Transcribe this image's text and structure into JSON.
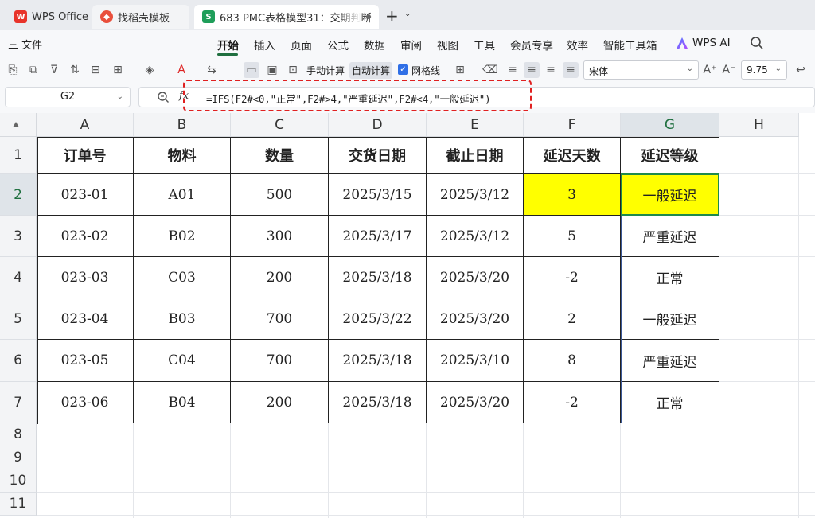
{
  "tabs": [
    {
      "label": "WPS Office",
      "icon": "wps-logo-icon"
    },
    {
      "label": "找稻壳模板",
      "icon": "docer-icon"
    },
    {
      "label": "683 PMC表格模型31：交期判断",
      "icon": "sheet-icon",
      "icon_text": "S"
    }
  ],
  "menu": {
    "file": "三 文件",
    "items": [
      "开始",
      "插入",
      "页面",
      "公式",
      "数据",
      "审阅",
      "视图",
      "工具",
      "会员专享",
      "效率",
      "智能工具箱"
    ],
    "active": "开始",
    "ai": "WPS AI"
  },
  "toolbar": {
    "manual_calc": "手动计算",
    "auto_calc": "自动计算",
    "gridlines": "网格线",
    "font": "宋体",
    "size": "9.75"
  },
  "formula_bar": {
    "name_box": "G2",
    "fx": "fx",
    "formula": "=IFS(F2#<0,\"正常\",F2#>4,\"严重延迟\",F2#<4,\"一般延迟\")"
  },
  "columns": [
    "A",
    "B",
    "C",
    "D",
    "E",
    "F",
    "G",
    "H"
  ],
  "rows": [
    "1",
    "2",
    "3",
    "4",
    "5",
    "6",
    "7",
    "8",
    "9",
    "10",
    "11"
  ],
  "table": {
    "headers": [
      "订单号",
      "物料",
      "数量",
      "交货日期",
      "截止日期",
      "延迟天数",
      "延迟等级"
    ],
    "rows": [
      [
        "023-01",
        "A01",
        "500",
        "2025/3/15",
        "2025/3/12",
        "3",
        "一般延迟"
      ],
      [
        "023-02",
        "B02",
        "300",
        "2025/3/17",
        "2025/3/12",
        "5",
        "严重延迟"
      ],
      [
        "023-03",
        "C03",
        "200",
        "2025/3/18",
        "2025/3/20",
        "-2",
        "正常"
      ],
      [
        "023-04",
        "B03",
        "700",
        "2025/3/22",
        "2025/3/20",
        "2",
        "一般延迟"
      ],
      [
        "023-05",
        "C04",
        "700",
        "2025/3/18",
        "2025/3/10",
        "8",
        "严重延迟"
      ],
      [
        "023-06",
        "B04",
        "200",
        "2025/3/18",
        "2025/3/20",
        "-2",
        "正常"
      ]
    ]
  },
  "colors": {
    "highlight": "#ffff00",
    "active_border": "#1f8a4c",
    "annotation": "#e02020"
  }
}
